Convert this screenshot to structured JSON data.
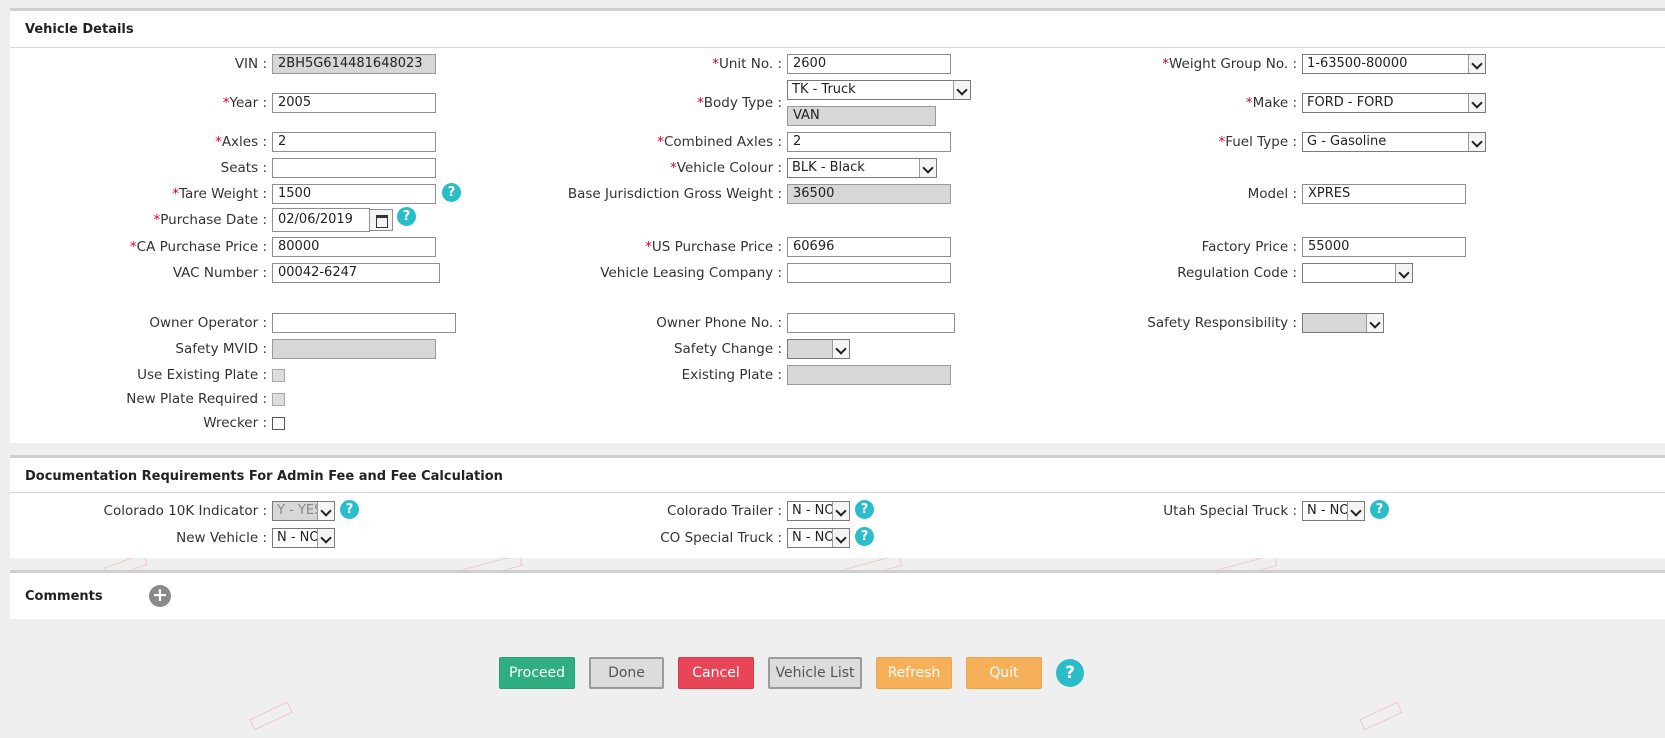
{
  "vehicle_details": {
    "title": "Vehicle Details",
    "vin_label": "VIN",
    "vin": "2BH5G614481648023",
    "unit_no_label": "Unit No.",
    "unit_no": "2600",
    "weight_group_label": "Weight Group No.",
    "weight_group": "1-63500-80000",
    "year_label": "Year",
    "year": "2005",
    "body_type_label": "Body Type",
    "body_type": "TK - Truck",
    "body_type_sub": "VAN",
    "make_label": "Make",
    "make": "FORD - FORD",
    "axles_label": "Axles",
    "axles": "2",
    "combined_axles_label": "Combined Axles",
    "combined_axles": "2",
    "fuel_type_label": "Fuel Type",
    "fuel_type": "G - Gasoline",
    "seats_label": "Seats",
    "seats": "",
    "vehicle_colour_label": "Vehicle Colour",
    "vehicle_colour": "BLK - Black",
    "tare_weight_label": "Tare Weight",
    "tare_weight": "1500",
    "base_gross_weight_label": "Base Jurisdiction Gross Weight",
    "base_gross_weight": "36500",
    "model_label": "Model",
    "model": "XPRES",
    "purchase_date_label": "Purchase Date",
    "purchase_date": "02/06/2019",
    "ca_price_label": "CA Purchase Price",
    "ca_price": "80000",
    "us_price_label": "US Purchase Price",
    "us_price": "60696",
    "factory_price_label": "Factory Price",
    "factory_price": "55000",
    "vac_label": "VAC Number",
    "vac": "00042-6247",
    "leasing_label": "Vehicle Leasing Company",
    "leasing": "",
    "regulation_label": "Regulation Code",
    "regulation": "",
    "owner_operator_label": "Owner Operator",
    "owner_operator": "",
    "owner_phone_label": "Owner Phone No.",
    "owner_phone": "",
    "safety_resp_label": "Safety Responsibility",
    "safety_resp": "",
    "safety_mvid_label": "Safety MVID",
    "safety_mvid": "",
    "safety_change_label": "Safety Change",
    "safety_change": "",
    "use_existing_label": "Use Existing Plate",
    "existing_plate_label": "Existing Plate",
    "existing_plate": "",
    "new_plate_label": "New Plate Required",
    "wrecker_label": "Wrecker"
  },
  "documentation": {
    "title": "Documentation Requirements For Admin Fee and Fee Calculation",
    "co10k_label": "Colorado 10K Indicator",
    "co10k": "Y - YES",
    "co_trailer_label": "Colorado Trailer",
    "co_trailer": "N - NO",
    "utah_label": "Utah Special Truck",
    "utah": "N - NO",
    "new_vehicle_label": "New Vehicle",
    "new_vehicle": "N - NO",
    "co_special_label": "CO Special Truck",
    "co_special": "N - NO"
  },
  "comments": {
    "title": "Comments"
  },
  "actions": {
    "proceed": "Proceed",
    "done": "Done",
    "cancel": "Cancel",
    "vehicle_list": "Vehicle List",
    "refresh": "Refresh",
    "quit": "Quit"
  },
  "common": {
    "colon": ":",
    "required_mark": "*",
    "help_glyph": "?",
    "plus_glyph": "+"
  },
  "icons": [
    "question-icon",
    "calendar-icon",
    "plus-circle-icon",
    "dropdown-arrow-icon"
  ],
  "colors": {
    "help": "#2bbcc9",
    "proceed": "#2fae81",
    "cancel": "#e84658",
    "refresh": "#f7b05a",
    "required": "#d9001b"
  }
}
